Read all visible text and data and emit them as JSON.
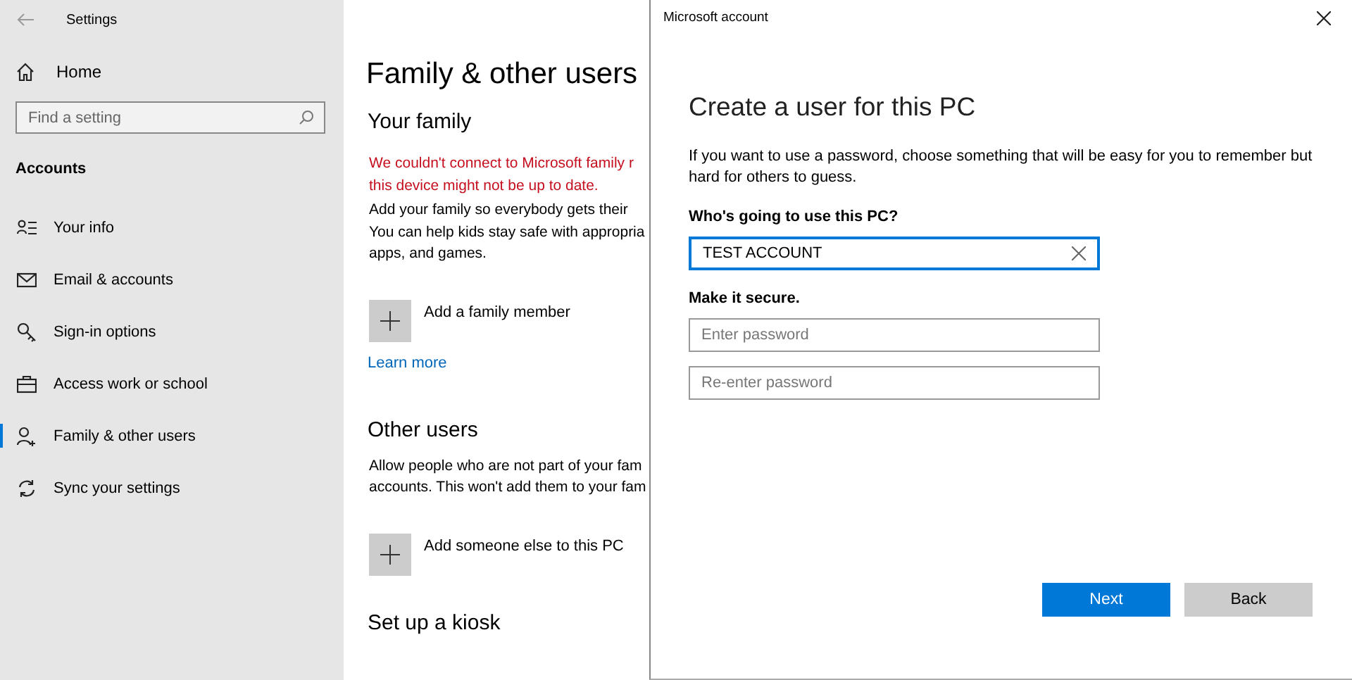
{
  "settings_window": {
    "title": "Settings",
    "home": "Home",
    "search": {
      "placeholder": "Find a setting"
    },
    "section": "Accounts",
    "nav_items": [
      {
        "label": "Your info",
        "selected": false
      },
      {
        "label": "Email & accounts",
        "selected": false
      },
      {
        "label": "Sign-in options",
        "selected": false
      },
      {
        "label": "Access work or school",
        "selected": false
      },
      {
        "label": "Family & other users",
        "selected": true
      },
      {
        "label": "Sync your settings",
        "selected": false
      }
    ]
  },
  "page": {
    "title": "Family & other users",
    "your_family": {
      "heading": "Your family",
      "error_lines": [
        "We couldn't connect to Microsoft family r",
        "this device might not be up to date."
      ],
      "text_lines": [
        "Add your family so everybody gets their",
        "You can help kids stay safe with appropria",
        "apps, and games."
      ],
      "add_button": "Add a family member",
      "link": "Learn more"
    },
    "other_users": {
      "heading": "Other users",
      "text_lines": [
        "Allow people who are not part of your fam",
        "accounts. This won't add them to your fam"
      ],
      "add_button": "Add someone else to this PC"
    },
    "kiosk": {
      "heading": "Set up a kiosk"
    }
  },
  "dialog": {
    "title": "Microsoft account",
    "heading": "Create a user for this PC",
    "description": "If you want to use a password, choose something that will be easy for you to remember but hard for others to guess.",
    "name_label": "Who's going to use this PC?",
    "name_field": {
      "value": "TEST ACCOUNT",
      "focused": true
    },
    "secure_label": "Make it secure.",
    "password_fields": [
      {
        "placeholder": "Enter password"
      },
      {
        "placeholder": "Re-enter password"
      }
    ],
    "buttons": [
      {
        "label": "Next",
        "kind": "primary"
      },
      {
        "label": "Back",
        "kind": "secondary"
      }
    ]
  }
}
